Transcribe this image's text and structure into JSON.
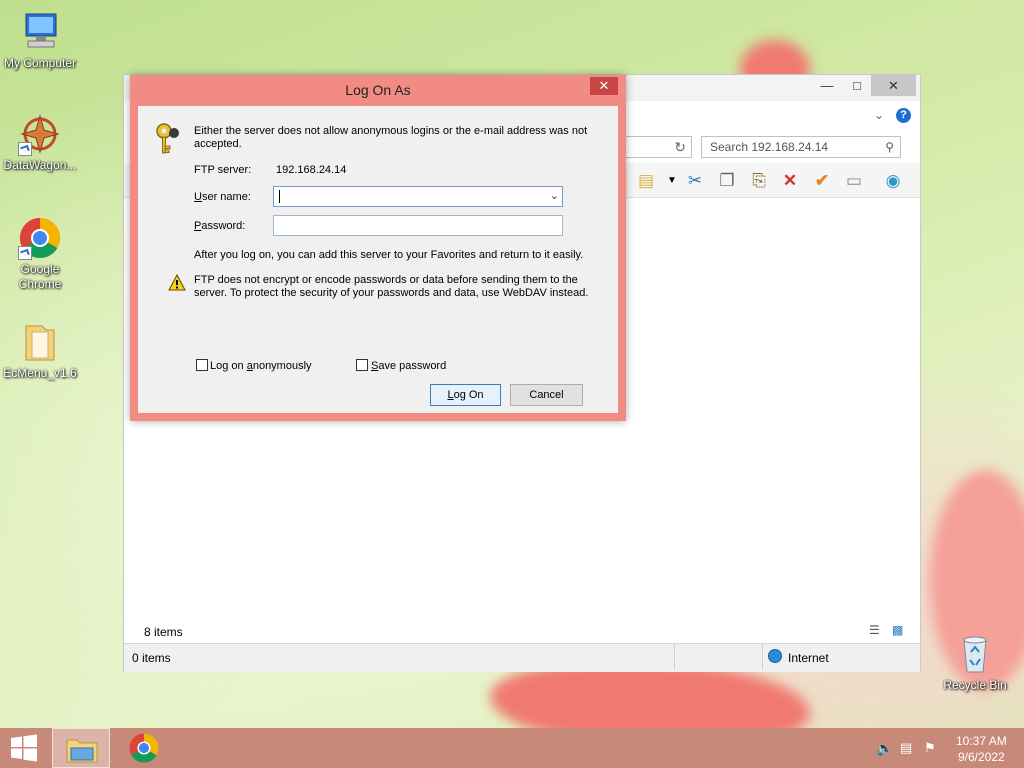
{
  "desktop": {
    "icons": [
      {
        "label": "My Computer",
        "icon": "computer-icon"
      },
      {
        "label": "DataWagon...",
        "icon": "datawagon-icon"
      },
      {
        "label": "Google Chrome",
        "icon": "chrome-icon"
      },
      {
        "label": "EcMenu_v1.6",
        "icon": "folder-icon"
      },
      {
        "label": "Recycle Bin",
        "icon": "recycle-bin-icon"
      }
    ]
  },
  "explorer": {
    "search_placeholder": "Search 192.168.24.14",
    "items_count": "8 items",
    "status_left": "0 items",
    "status_zone": "Internet"
  },
  "dialog": {
    "title": "Log On As",
    "message": "Either the server does not allow anonymous logins or the e-mail address was not accepted.",
    "ftp_server_label": "FTP server:",
    "ftp_server_value": "192.168.24.14",
    "username_label_u": "U",
    "username_label_rest": "ser name:",
    "username_value": "",
    "password_label_p": "P",
    "password_label_rest": "assword:",
    "password_value": "",
    "favorites_note": "After you log on, you can add this server to your Favorites and return to it easily.",
    "warning_text": "FTP does not encrypt or encode passwords or data before sending them to the server.  To protect the security of your passwords and data, use WebDAV instead.",
    "anon_label_pre": "Log on ",
    "anon_label_u": "a",
    "anon_label_post": "nonymously",
    "save_label_u": "S",
    "save_label_post": "ave password",
    "logon_button_u": "L",
    "logon_button_post": "og On",
    "cancel_button": "Cancel"
  },
  "taskbar": {
    "time": "10:37 AM",
    "date": "9/6/2022"
  },
  "colors": {
    "dialog_frame": "#f28b82",
    "taskbar": "#c88a78"
  }
}
